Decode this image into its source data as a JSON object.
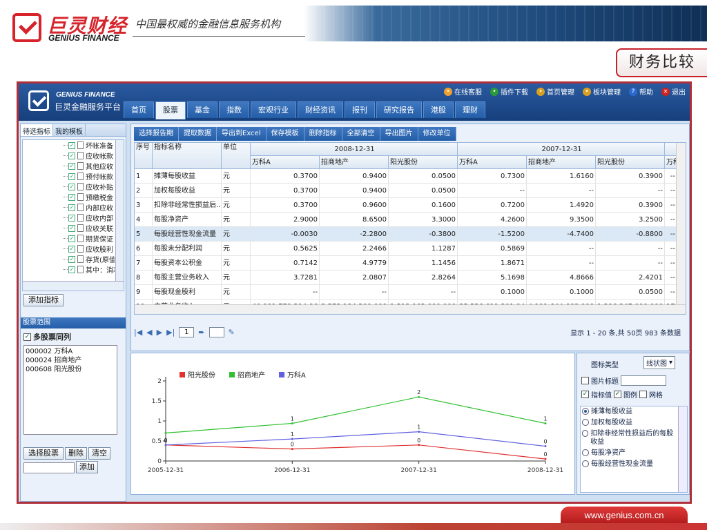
{
  "banner": {
    "logo_cn": "巨灵财经",
    "logo_en": "GENIUS FINANCE",
    "slogan": "中国最权威的金融信息服务机构",
    "page_label": "财务比较"
  },
  "app": {
    "brand_en": "GENIUS FINANCE",
    "brand_cn": "巨灵金融服务平台",
    "top_links": [
      {
        "label": "在线客服",
        "icon": "support-icon",
        "color": "#f0a030"
      },
      {
        "label": "插件下载",
        "icon": "download-icon",
        "color": "#2a9a3a"
      },
      {
        "label": "首页管理",
        "icon": "gear-icon",
        "color": "#d9a020"
      },
      {
        "label": "板块管理",
        "icon": "gear-icon",
        "color": "#d9a020"
      },
      {
        "label": "帮助",
        "icon": "help-icon",
        "color": "#2a6ad0"
      },
      {
        "label": "退出",
        "icon": "close-icon",
        "color": "#d02020"
      }
    ],
    "nav_tabs": [
      "首页",
      "股票",
      "基金",
      "指数",
      "宏观行业",
      "财经资讯",
      "报刊",
      "研究报告",
      "港股",
      "理财"
    ],
    "active_tab": "股票"
  },
  "left": {
    "tabs": [
      "待选指标",
      "我的模板"
    ],
    "tree_items": [
      "坏帐准备",
      "应收帐款",
      "其他应收",
      "预付帐款",
      "应收补贴",
      "预缴税金",
      "内部应收",
      "应收内部",
      "应收关联",
      "期货保证",
      "应收股利",
      "存货(原值)",
      "其中：消耗"
    ],
    "add_indicator": "添加指标",
    "stock_range_title": "股票范围",
    "multi_stock_label": "多股票同列",
    "stocks": [
      "000002 万科A",
      "000024 招商地产",
      "000608 阳光股份"
    ],
    "select_stock": "选择股票",
    "delete": "删除",
    "clear": "清空",
    "add": "添加"
  },
  "toolbar": [
    "选择报告期",
    "提取数据",
    "导出到Excel",
    "保存模板",
    "删除指标",
    "全部清空",
    "导出图片",
    "修改单位"
  ],
  "grid": {
    "col_seq": "序号",
    "col_name": "指标名称",
    "col_unit": "单位",
    "periods": [
      "2008-12-31",
      "2007-12-31"
    ],
    "stocks": [
      "万科A",
      "招商地产",
      "阳光股份"
    ],
    "extra_stock_header": "万科A",
    "rows": [
      {
        "seq": "1",
        "name": "摊薄每股收益",
        "unit": "元",
        "v": [
          "0.3700",
          "0.9400",
          "0.0500",
          "0.7300",
          "1.6160",
          "0.3900"
        ],
        "x": "--"
      },
      {
        "seq": "2",
        "name": "加权每股收益",
        "unit": "元",
        "v": [
          "0.3700",
          "0.9400",
          "0.0500",
          "--",
          "--",
          "--"
        ],
        "x": "--"
      },
      {
        "seq": "3",
        "name": "扣除非经常性损益后...",
        "unit": "元",
        "v": [
          "0.3700",
          "0.9600",
          "0.1600",
          "0.7200",
          "1.4920",
          "0.3900"
        ],
        "x": "--"
      },
      {
        "seq": "4",
        "name": "每股净资产",
        "unit": "元",
        "v": [
          "2.9000",
          "8.6500",
          "3.3000",
          "4.2600",
          "9.3500",
          "3.2500"
        ],
        "x": "--"
      },
      {
        "seq": "5",
        "name": "每股经营性现金流量",
        "unit": "元",
        "v": [
          "-0.0030",
          "-2.2800",
          "-0.3800",
          "-1.5200",
          "-4.7400",
          "-0.8800"
        ],
        "x": "--"
      },
      {
        "seq": "6",
        "name": "每股未分配利润",
        "unit": "元",
        "v": [
          "0.5625",
          "2.2466",
          "1.1287",
          "0.5869",
          "--",
          "--"
        ],
        "x": "--"
      },
      {
        "seq": "7",
        "name": "每股资本公积金",
        "unit": "元",
        "v": [
          "0.7142",
          "4.9779",
          "1.1456",
          "1.8671",
          "--",
          "--"
        ],
        "x": "--"
      },
      {
        "seq": "8",
        "name": "每股主营业务收入",
        "unit": "元",
        "v": [
          "3.7281",
          "2.0807",
          "2.8264",
          "5.1698",
          "4.8666",
          "2.4201"
        ],
        "x": "--"
      },
      {
        "seq": "9",
        "name": "每股现金股利",
        "unit": "元",
        "v": [
          "--",
          "--",
          "--",
          "0.1000",
          "0.1000",
          "0.0500"
        ],
        "x": "--"
      },
      {
        "seq": "10",
        "name": "主营业务收入",
        "unit": "元",
        "v": [
          "40,991,779,214.96...",
          "3,573,184,200.0000",
          "1,513,962,000.0000",
          "35,526,611,301.94...",
          "4,111,644,668.0000",
          "1,296,347,000.0000"
        ],
        "x": "17,8"
      }
    ],
    "highlight_row": 4
  },
  "pager": {
    "page": "1",
    "info": "显示 1 - 20 条,共 50页 983 条数据"
  },
  "chart_ctrl": {
    "type_label": "图标类型",
    "type_value": "线状图",
    "title_label": "图片标题",
    "value_label": "指标值",
    "legend_label": "图例",
    "grid_label": "网格",
    "indicators": [
      "摊薄每股收益",
      "加权每股收益",
      "扣除非经常性损益后的每股收益",
      "每股净资产",
      "每股经营性现金流量"
    ]
  },
  "chart_data": {
    "type": "line",
    "x": [
      "2005-12-31",
      "2006-12-31",
      "2007-12-31",
      "2008-12-31"
    ],
    "series": [
      {
        "name": "阳光股份",
        "color": "#e03030",
        "values": [
          0.4,
          0.3,
          0.4,
          0.05
        ]
      },
      {
        "name": "招商地产",
        "color": "#30c030",
        "values": [
          0.7,
          0.94,
          1.6,
          0.94
        ]
      },
      {
        "name": "万科A",
        "color": "#6060e0",
        "values": [
          0.4,
          0.55,
          0.73,
          0.37
        ]
      }
    ],
    "point_labels": [
      [
        "0",
        "0",
        "0",
        "0"
      ],
      [
        "",
        "1",
        "2",
        "1"
      ],
      [
        "0",
        "1",
        "1",
        "0"
      ]
    ],
    "y_ticks": [
      "0",
      "0.5",
      "1",
      "1.5",
      "2"
    ],
    "ylim": [
      0,
      2
    ],
    "grid": false,
    "legend": "top-left"
  },
  "footer": {
    "url": "www.genius.com.cn"
  }
}
